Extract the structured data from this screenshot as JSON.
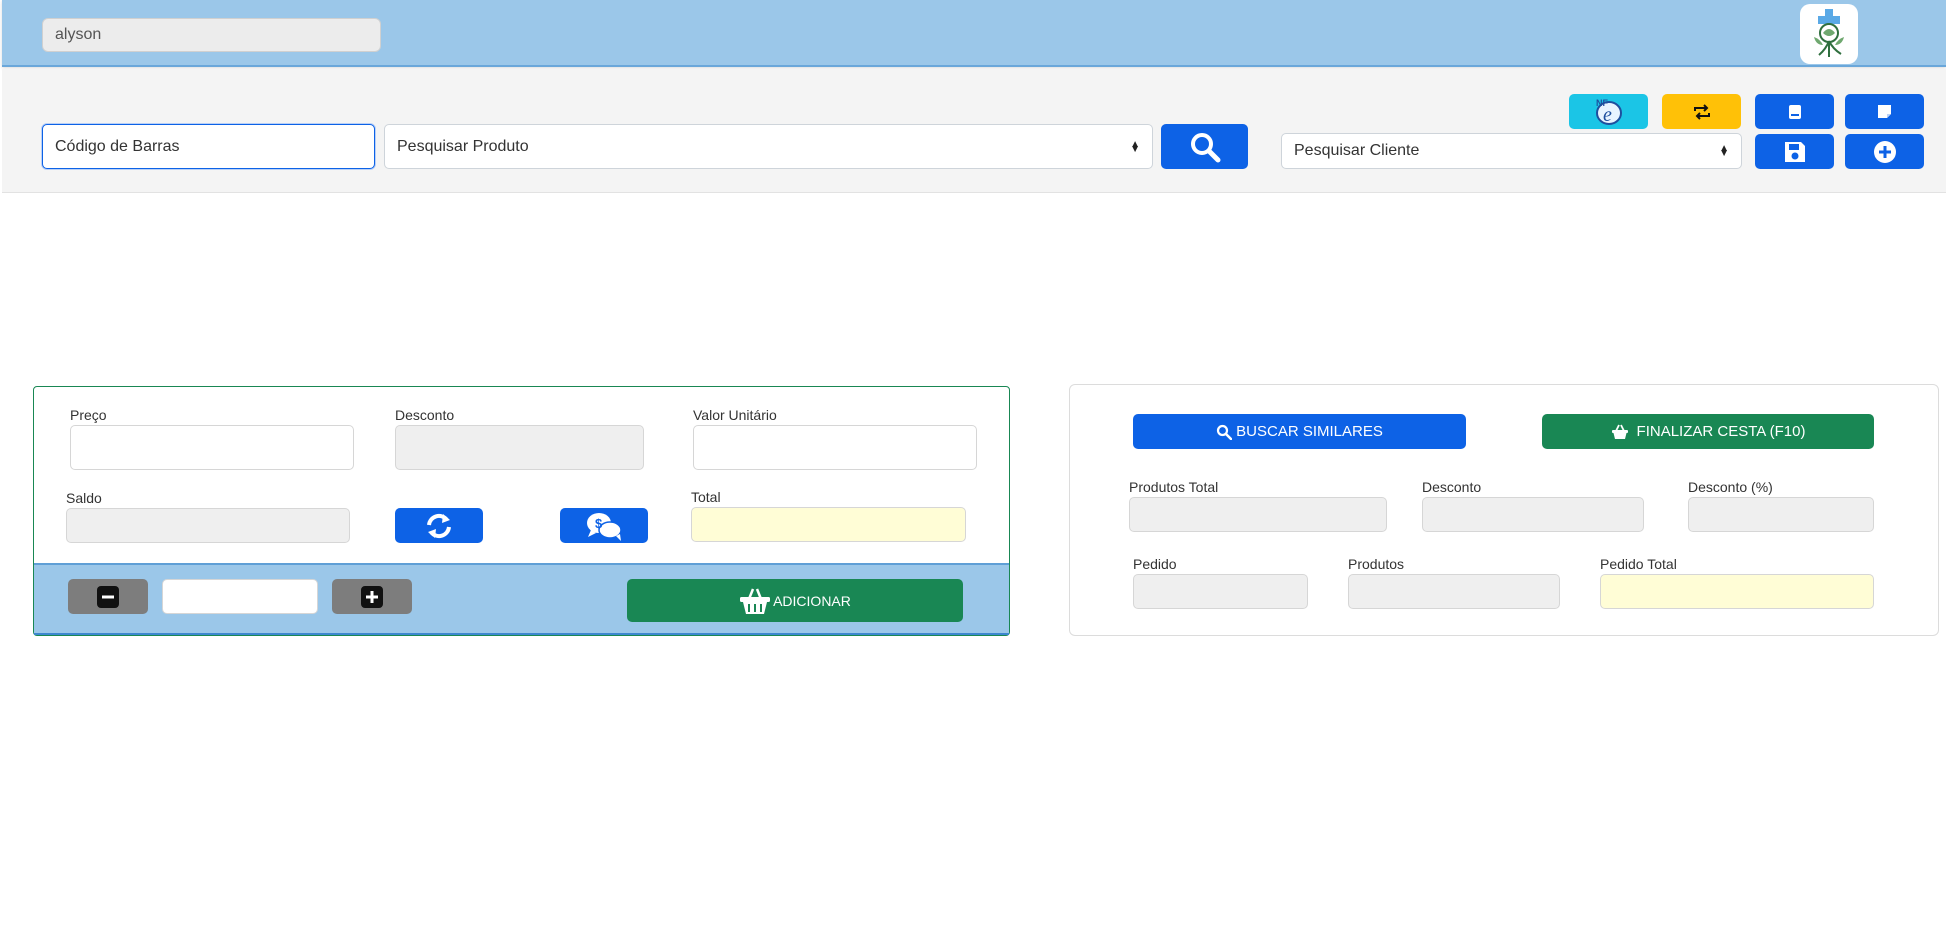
{
  "header": {
    "user": "alyson"
  },
  "search": {
    "barcode_placeholder": "Código de Barras",
    "product_select": "Pesquisar Produto",
    "client_select": "Pesquisar Cliente"
  },
  "item_panel": {
    "price_label": "Preço",
    "discount_label": "Desconto",
    "unit_value_label": "Valor Unitário",
    "balance_label": "Saldo",
    "total_label": "Total",
    "add_label": "ADICIONAR"
  },
  "order_panel": {
    "similar_label": "BUSCAR SIMILARES",
    "finish_label": "FINALIZAR CESTA (F10)",
    "products_total_label": "Produtos Total",
    "discount_label": "Desconto",
    "discount_pct_label": "Desconto (%)",
    "order_label": "Pedido",
    "products_label": "Produtos",
    "order_total_label": "Pedido Total"
  },
  "colors": {
    "primary": "#0d62e6",
    "success": "#198754",
    "warning": "#ffc107",
    "info": "#1bc5e6",
    "header": "#9bc7e9"
  }
}
